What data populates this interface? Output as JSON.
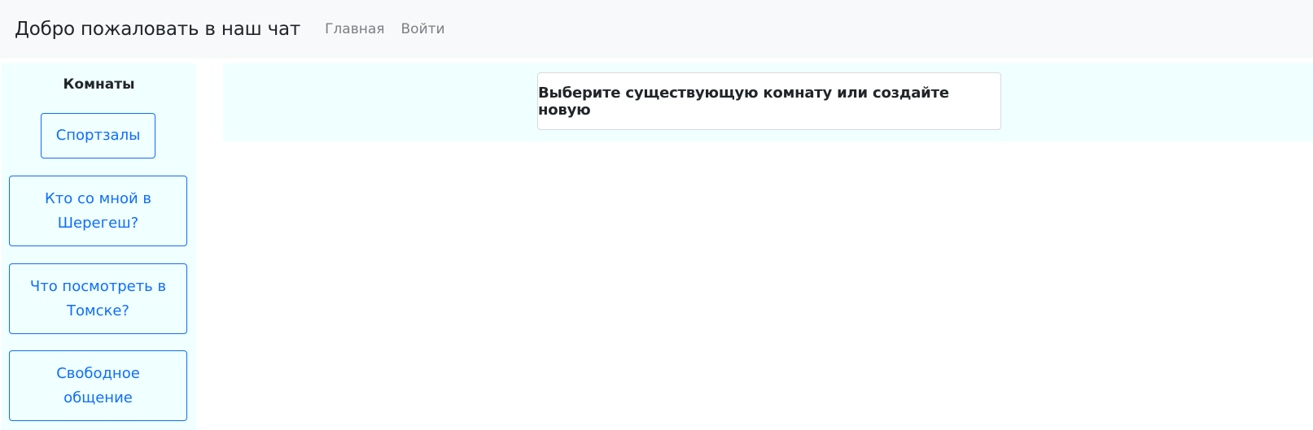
{
  "navbar": {
    "brand": "Добро пожаловать в наш чат",
    "links": [
      {
        "label": "Главная"
      },
      {
        "label": "Войти"
      }
    ]
  },
  "sidebar": {
    "title": "Комнаты",
    "rooms": [
      {
        "label": "Спортзалы"
      },
      {
        "label": "Кто со мной в Шерегеш?"
      },
      {
        "label": "Что посмотреть в Томске?"
      },
      {
        "label": "Свободное общение"
      }
    ]
  },
  "main": {
    "prompt": "Выберите существующую комнату или создайте новую"
  },
  "colors": {
    "navbar_bg": "#f8f9fa",
    "panel_bg": "#f0ffff",
    "accent": "#0d6efd"
  }
}
